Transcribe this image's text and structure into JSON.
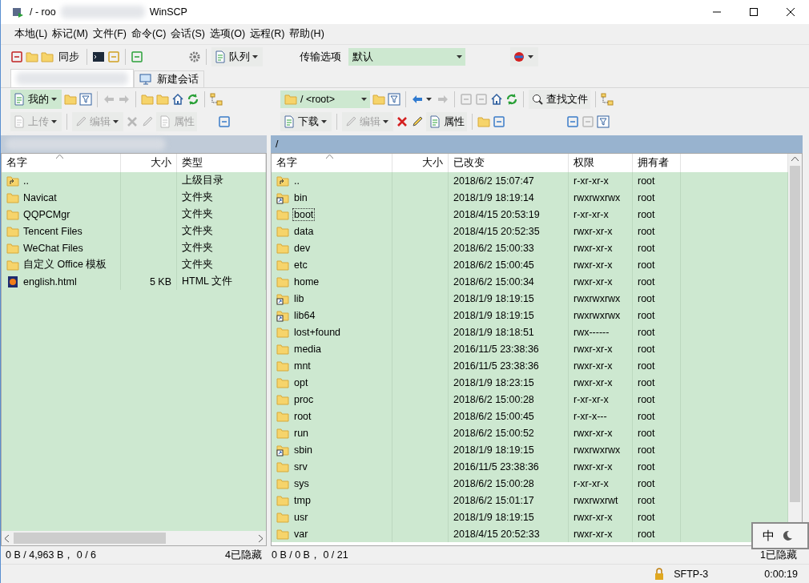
{
  "window": {
    "title_start": "/ - roo",
    "title_end": "WinSCP"
  },
  "menu": [
    "本地(L)",
    "标记(M)",
    "文件(F)",
    "命令(C)",
    "会话(S)",
    "选项(O)",
    "远程(R)",
    "帮助(H)"
  ],
  "toolbar": {
    "sync": "同步",
    "queue": "队列",
    "transfer_label": "传输选项",
    "transfer_value": "默认"
  },
  "tabs": [
    {
      "kind": "session",
      "selected": true
    },
    {
      "kind": "new",
      "label": "新建会话",
      "selected": false
    }
  ],
  "left_pane": {
    "location": "我的",
    "actions": [
      {
        "label": "上传",
        "disabled": true
      },
      {
        "label": "编辑",
        "disabled": true
      },
      {
        "label": "属性",
        "disabled": true
      }
    ],
    "columns": [
      "名字",
      "大小",
      "类型"
    ],
    "rows": [
      {
        "kind": "parent",
        "name": "..",
        "size": "",
        "type": "上级目录"
      },
      {
        "kind": "folder",
        "name": "Navicat",
        "size": "",
        "type": "文件夹"
      },
      {
        "kind": "folder",
        "name": "QQPCMgr",
        "size": "",
        "type": "文件夹"
      },
      {
        "kind": "folder",
        "name": "Tencent Files",
        "size": "",
        "type": "文件夹"
      },
      {
        "kind": "folder",
        "name": "WeChat Files",
        "size": "",
        "type": "文件夹"
      },
      {
        "kind": "folder",
        "name": "自定义 Office 模板",
        "size": "",
        "type": "文件夹"
      },
      {
        "kind": "html",
        "name": "english.html",
        "size": "5 KB",
        "type": "HTML 文件"
      }
    ],
    "status": "0 B / 4,963 B， 0 / 6",
    "hidden": "4已隐藏"
  },
  "right_pane": {
    "location": "/ <root>",
    "find": "查找文件",
    "actions": [
      {
        "label": "下载",
        "disabled": false
      },
      {
        "label": "编辑",
        "disabled": true
      },
      {
        "label": "属性",
        "disabled": false
      }
    ],
    "path": "/",
    "columns": [
      "名字",
      "大小",
      "已改变",
      "权限",
      "拥有者"
    ],
    "rows": [
      {
        "kind": "parent",
        "name": "..",
        "changed": "2018/6/2 15:07:47",
        "rights": "r-xr-xr-x",
        "owner": "root",
        "focused": false
      },
      {
        "kind": "link",
        "name": "bin",
        "changed": "2018/1/9 18:19:14",
        "rights": "rwxrwxrwx",
        "owner": "root",
        "focused": false
      },
      {
        "kind": "folder",
        "name": "boot",
        "changed": "2018/4/15 20:53:19",
        "rights": "r-xr-xr-x",
        "owner": "root",
        "focused": true
      },
      {
        "kind": "folder",
        "name": "data",
        "changed": "2018/4/15 20:52:35",
        "rights": "rwxr-xr-x",
        "owner": "root",
        "focused": false
      },
      {
        "kind": "folder",
        "name": "dev",
        "changed": "2018/6/2 15:00:33",
        "rights": "rwxr-xr-x",
        "owner": "root",
        "focused": false
      },
      {
        "kind": "folder",
        "name": "etc",
        "changed": "2018/6/2 15:00:45",
        "rights": "rwxr-xr-x",
        "owner": "root",
        "focused": false
      },
      {
        "kind": "folder",
        "name": "home",
        "changed": "2018/6/2 15:00:34",
        "rights": "rwxr-xr-x",
        "owner": "root",
        "focused": false
      },
      {
        "kind": "link",
        "name": "lib",
        "changed": "2018/1/9 18:19:15",
        "rights": "rwxrwxrwx",
        "owner": "root",
        "focused": false
      },
      {
        "kind": "link",
        "name": "lib64",
        "changed": "2018/1/9 18:19:15",
        "rights": "rwxrwxrwx",
        "owner": "root",
        "focused": false
      },
      {
        "kind": "folder",
        "name": "lost+found",
        "changed": "2018/1/9 18:18:51",
        "rights": "rwx------",
        "owner": "root",
        "focused": false
      },
      {
        "kind": "folder",
        "name": "media",
        "changed": "2016/11/5 23:38:36",
        "rights": "rwxr-xr-x",
        "owner": "root",
        "focused": false
      },
      {
        "kind": "folder",
        "name": "mnt",
        "changed": "2016/11/5 23:38:36",
        "rights": "rwxr-xr-x",
        "owner": "root",
        "focused": false
      },
      {
        "kind": "folder",
        "name": "opt",
        "changed": "2018/1/9 18:23:15",
        "rights": "rwxr-xr-x",
        "owner": "root",
        "focused": false
      },
      {
        "kind": "folder",
        "name": "proc",
        "changed": "2018/6/2 15:00:28",
        "rights": "r-xr-xr-x",
        "owner": "root",
        "focused": false
      },
      {
        "kind": "folder",
        "name": "root",
        "changed": "2018/6/2 15:00:45",
        "rights": "r-xr-x---",
        "owner": "root",
        "focused": false
      },
      {
        "kind": "folder",
        "name": "run",
        "changed": "2018/6/2 15:00:52",
        "rights": "rwxr-xr-x",
        "owner": "root",
        "focused": false
      },
      {
        "kind": "link",
        "name": "sbin",
        "changed": "2018/1/9 18:19:15",
        "rights": "rwxrwxrwx",
        "owner": "root",
        "focused": false
      },
      {
        "kind": "folder",
        "name": "srv",
        "changed": "2016/11/5 23:38:36",
        "rights": "rwxr-xr-x",
        "owner": "root",
        "focused": false
      },
      {
        "kind": "folder",
        "name": "sys",
        "changed": "2018/6/2 15:00:28",
        "rights": "r-xr-xr-x",
        "owner": "root",
        "focused": false
      },
      {
        "kind": "folder",
        "name": "tmp",
        "changed": "2018/6/2 15:01:17",
        "rights": "rwxrwxrwt",
        "owner": "root",
        "focused": false
      },
      {
        "kind": "folder",
        "name": "usr",
        "changed": "2018/1/9 18:19:15",
        "rights": "rwxr-xr-x",
        "owner": "root",
        "focused": false
      },
      {
        "kind": "folder",
        "name": "var",
        "changed": "2018/4/15 20:52:33",
        "rights": "rwxr-xr-x",
        "owner": "root",
        "focused": false
      }
    ],
    "status": "0 B / 0 B， 0 / 21",
    "hidden": "1已隐藏"
  },
  "status_bar": {
    "protocol": "SFTP-3",
    "time": "0:00:19"
  },
  "ime": {
    "label": "中"
  }
}
